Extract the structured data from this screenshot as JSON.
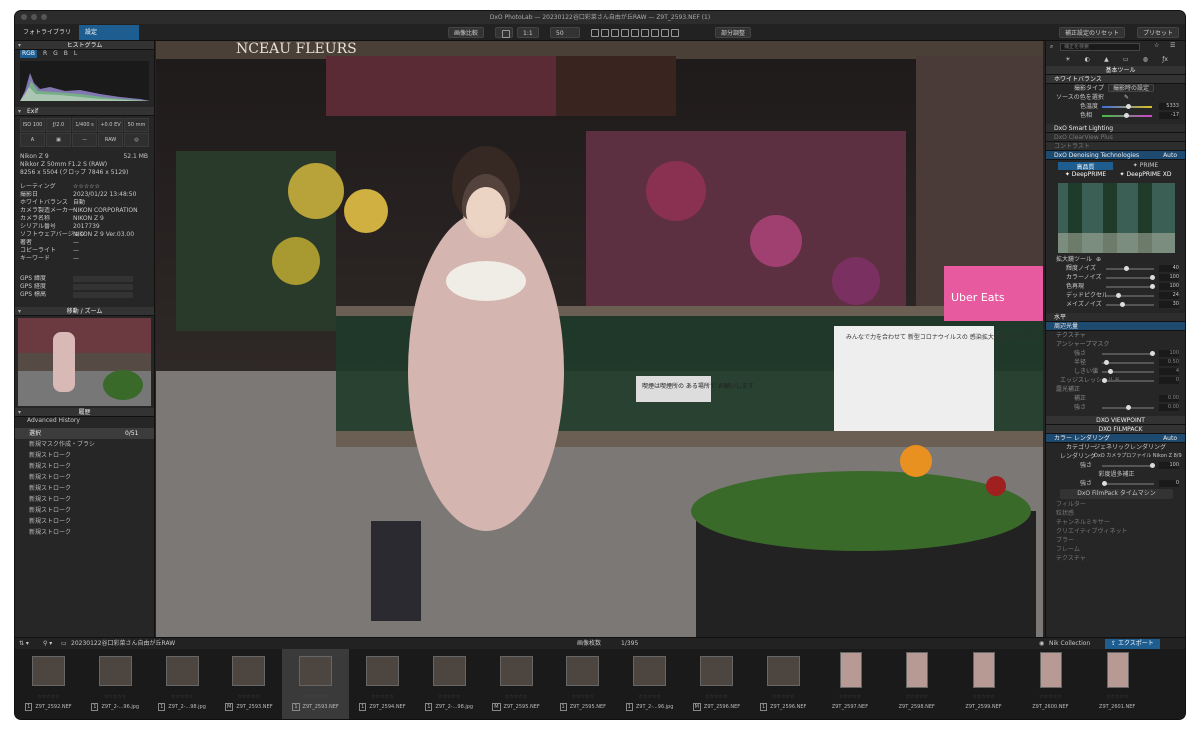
{
  "window_title": "DxO PhotoLab — 20230122谷口彩菜さん自由が丘RAW — Z9T_2593.NEF (1)",
  "tabs": [
    "フォトライブラリ",
    "設定"
  ],
  "toolbar": {
    "compare": "画像比較",
    "zoom": "1:1",
    "zoom_value": "50",
    "local_adjust": "部分調整",
    "reset": "補正設定のリセット",
    "preset": "プリセット"
  },
  "left": {
    "histogram_title": "ヒストグラム",
    "histogram_channels": [
      "RGB",
      "R",
      "G",
      "B",
      "L"
    ],
    "exif_title": "Exif",
    "exif_grid": [
      "ISO 100",
      "ƒ/2.0",
      "1/400 s",
      "+0.0 EV",
      "50 mm",
      "A",
      "",
      "—",
      "RAW",
      ""
    ],
    "camera": "Nikon Z 9",
    "size": "52.1 MB",
    "lens": "Nikkor Z 50mm F1.2 S (RAW)",
    "dims": "8256 x 5504 (クロップ 7846 x 5129)",
    "meta": [
      {
        "k": "レーティング",
        "v": "☆☆☆☆☆"
      },
      {
        "k": "撮影日",
        "v": "2023/01/22 13:48:50"
      },
      {
        "k": "ホワイトバランス",
        "v": "自動"
      },
      {
        "k": "カメラ製造メーカー",
        "v": "NIKON CORPORATION"
      },
      {
        "k": "カメラ名称",
        "v": "NIKON Z 9"
      },
      {
        "k": "シリアル番号",
        "v": "2017739"
      },
      {
        "k": "ソフトウェアバージョン",
        "v": "NIKON Z 9 Ver.03.00"
      },
      {
        "k": "著者",
        "v": "—"
      },
      {
        "k": "コピーライト",
        "v": "—"
      },
      {
        "k": "キーワード",
        "v": "—"
      }
    ],
    "gps": [
      "GPS 緯度",
      "GPS 経度",
      "GPS 標高"
    ],
    "nav_title": "移動 / ズーム",
    "history_title": "履歴",
    "history_sub": "Advanced History",
    "history_items": [
      "選択",
      "新規マスク作成・ブラシ",
      "新規ストローク",
      "新規ストローク",
      "新規ストローク",
      "新規ストローク",
      "新規ストローク",
      "新規ストローク",
      "新規ストローク",
      "新規ストローク"
    ],
    "history_count": "0/51"
  },
  "photo_texts": {
    "sign": "NCEAU FLEURS",
    "board": "喫煙は喫煙所の\nある場所で\nお願いします",
    "poster": "みんなで力を合わせて\n新型コロナウイルスの\n感染拡大を防ぎましょう！",
    "ubereats": "Uber Eats"
  },
  "right": {
    "search_placeholder": "補正を検索",
    "basic_tools": "基本ツール",
    "wb": "ホワイトバランス",
    "wb_type_label": "撮影タイプ",
    "wb_type_value": "撮影時の設定",
    "wb_picker": "ソースの色を選択",
    "temp_label": "色温度",
    "temp_value": "5333",
    "tint_label": "色相",
    "tint_value": "-17",
    "smart_lighting": "DxO Smart Lighting",
    "clearview": "DxO ClearView Plus",
    "contrast": "コントラスト",
    "denoise": "DxO Denoising Technologies",
    "denoise_mode": "Auto",
    "hq": "高品質",
    "prime": "PRIME",
    "deepprime": "DeepPRIME",
    "deepprime_xd": "DeepPRIME XD",
    "preview_tool": "拡大鏡ツール",
    "nr": [
      {
        "k": "輝度ノイズ",
        "v": "40"
      },
      {
        "k": "カラーノイズ",
        "v": "100"
      },
      {
        "k": "色再現",
        "v": "100"
      },
      {
        "k": "デッドピクセル",
        "v": "24"
      },
      {
        "k": "メイズノイズ",
        "v": "30"
      }
    ],
    "horizon": "水平",
    "vignette": "周辺光量",
    "sub_items": [
      "テクスチャ",
      "アンシャープマスク",
      "強さ",
      "半径",
      "しきい値",
      "エッジスレッショルド"
    ],
    "sub_values": [
      "100",
      "0.50",
      "4",
      "0"
    ],
    "extra": [
      "露光補正",
      "補正",
      "強さ"
    ],
    "extra_values": [
      "0.00",
      "0.00"
    ],
    "viewpoint": "DXO VIEWPOINT",
    "filmpack": "DXO FILMPACK",
    "color_render": "カラー レンダリング",
    "color_mode": "Auto",
    "category_label": "カテゴリー",
    "category_value": "ジェネリックレンダリング",
    "render_label": "レンダリング",
    "render_value": "DxO カメラプロファイル Nikon Z 8/9",
    "strength_label": "強さ",
    "strength_value": "100",
    "gamut": "彩度過多補正",
    "gamut_strength": "0",
    "timemachine": "DxO FilmPack タイムマシン",
    "more": [
      "フィルター",
      "粒状感",
      "チャンネルミキサー",
      "クリエイティブヴィネット",
      "ブラー",
      "フレーム",
      "テクスチャ"
    ]
  },
  "filmbar": {
    "folder": "20230122谷口彩菜さん自由が丘RAW",
    "count_label": "画像枚数",
    "count": "1/395",
    "nik": "Nik Collection",
    "export": "エクスポート"
  },
  "thumbs": [
    {
      "name": "Z9T_2592.NEF",
      "badge": "1"
    },
    {
      "name": "Z9T_2-...96.jpg",
      "badge": "1"
    },
    {
      "name": "Z9T_2-...98.jpg",
      "badge": "1"
    },
    {
      "name": "Z9T_2593.NEF",
      "badge": "M"
    },
    {
      "name": "Z9T_2593.NEF",
      "badge": "1"
    },
    {
      "name": "Z9T_2594.NEF",
      "badge": "1"
    },
    {
      "name": "Z9T_2-...98.jpg",
      "badge": "1"
    },
    {
      "name": "Z9T_2595.NEF",
      "badge": "M"
    },
    {
      "name": "Z9T_2595.NEF",
      "badge": "1"
    },
    {
      "name": "Z9T_2-...96.jpg",
      "badge": "1"
    },
    {
      "name": "Z9T_2596.NEF",
      "badge": "M"
    },
    {
      "name": "Z9T_2596.NEF",
      "badge": "1"
    },
    {
      "name": "Z9T_2597.NEF",
      "badge": ""
    },
    {
      "name": "Z9T_2598.NEF",
      "badge": ""
    },
    {
      "name": "Z9T_2599.NEF",
      "badge": ""
    },
    {
      "name": "Z9T_2600.NEF",
      "badge": ""
    },
    {
      "name": "Z9T_2601.NEF",
      "badge": ""
    }
  ],
  "colors": {
    "accent": "#1e5d8f",
    "panel": "#262626"
  }
}
